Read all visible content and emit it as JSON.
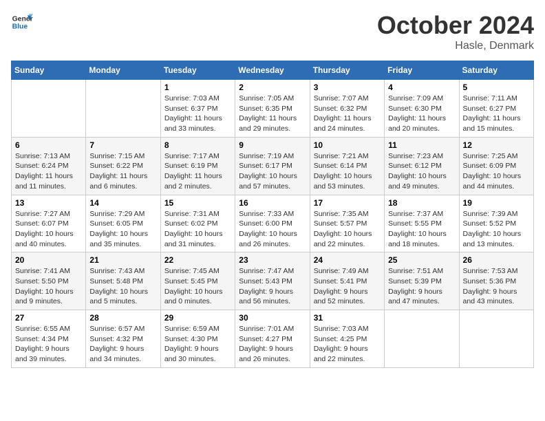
{
  "header": {
    "logo_line1": "General",
    "logo_line2": "Blue",
    "month": "October 2024",
    "location": "Hasle, Denmark"
  },
  "weekdays": [
    "Sunday",
    "Monday",
    "Tuesday",
    "Wednesday",
    "Thursday",
    "Friday",
    "Saturday"
  ],
  "weeks": [
    [
      {
        "day": "",
        "info": ""
      },
      {
        "day": "",
        "info": ""
      },
      {
        "day": "1",
        "info": "Sunrise: 7:03 AM\nSunset: 6:37 PM\nDaylight: 11 hours\nand 33 minutes."
      },
      {
        "day": "2",
        "info": "Sunrise: 7:05 AM\nSunset: 6:35 PM\nDaylight: 11 hours\nand 29 minutes."
      },
      {
        "day": "3",
        "info": "Sunrise: 7:07 AM\nSunset: 6:32 PM\nDaylight: 11 hours\nand 24 minutes."
      },
      {
        "day": "4",
        "info": "Sunrise: 7:09 AM\nSunset: 6:30 PM\nDaylight: 11 hours\nand 20 minutes."
      },
      {
        "day": "5",
        "info": "Sunrise: 7:11 AM\nSunset: 6:27 PM\nDaylight: 11 hours\nand 15 minutes."
      }
    ],
    [
      {
        "day": "6",
        "info": "Sunrise: 7:13 AM\nSunset: 6:24 PM\nDaylight: 11 hours\nand 11 minutes."
      },
      {
        "day": "7",
        "info": "Sunrise: 7:15 AM\nSunset: 6:22 PM\nDaylight: 11 hours\nand 6 minutes."
      },
      {
        "day": "8",
        "info": "Sunrise: 7:17 AM\nSunset: 6:19 PM\nDaylight: 11 hours\nand 2 minutes."
      },
      {
        "day": "9",
        "info": "Sunrise: 7:19 AM\nSunset: 6:17 PM\nDaylight: 10 hours\nand 57 minutes."
      },
      {
        "day": "10",
        "info": "Sunrise: 7:21 AM\nSunset: 6:14 PM\nDaylight: 10 hours\nand 53 minutes."
      },
      {
        "day": "11",
        "info": "Sunrise: 7:23 AM\nSunset: 6:12 PM\nDaylight: 10 hours\nand 49 minutes."
      },
      {
        "day": "12",
        "info": "Sunrise: 7:25 AM\nSunset: 6:09 PM\nDaylight: 10 hours\nand 44 minutes."
      }
    ],
    [
      {
        "day": "13",
        "info": "Sunrise: 7:27 AM\nSunset: 6:07 PM\nDaylight: 10 hours\nand 40 minutes."
      },
      {
        "day": "14",
        "info": "Sunrise: 7:29 AM\nSunset: 6:05 PM\nDaylight: 10 hours\nand 35 minutes."
      },
      {
        "day": "15",
        "info": "Sunrise: 7:31 AM\nSunset: 6:02 PM\nDaylight: 10 hours\nand 31 minutes."
      },
      {
        "day": "16",
        "info": "Sunrise: 7:33 AM\nSunset: 6:00 PM\nDaylight: 10 hours\nand 26 minutes."
      },
      {
        "day": "17",
        "info": "Sunrise: 7:35 AM\nSunset: 5:57 PM\nDaylight: 10 hours\nand 22 minutes."
      },
      {
        "day": "18",
        "info": "Sunrise: 7:37 AM\nSunset: 5:55 PM\nDaylight: 10 hours\nand 18 minutes."
      },
      {
        "day": "19",
        "info": "Sunrise: 7:39 AM\nSunset: 5:52 PM\nDaylight: 10 hours\nand 13 minutes."
      }
    ],
    [
      {
        "day": "20",
        "info": "Sunrise: 7:41 AM\nSunset: 5:50 PM\nDaylight: 10 hours\nand 9 minutes."
      },
      {
        "day": "21",
        "info": "Sunrise: 7:43 AM\nSunset: 5:48 PM\nDaylight: 10 hours\nand 5 minutes."
      },
      {
        "day": "22",
        "info": "Sunrise: 7:45 AM\nSunset: 5:45 PM\nDaylight: 10 hours\nand 0 minutes."
      },
      {
        "day": "23",
        "info": "Sunrise: 7:47 AM\nSunset: 5:43 PM\nDaylight: 9 hours\nand 56 minutes."
      },
      {
        "day": "24",
        "info": "Sunrise: 7:49 AM\nSunset: 5:41 PM\nDaylight: 9 hours\nand 52 minutes."
      },
      {
        "day": "25",
        "info": "Sunrise: 7:51 AM\nSunset: 5:39 PM\nDaylight: 9 hours\nand 47 minutes."
      },
      {
        "day": "26",
        "info": "Sunrise: 7:53 AM\nSunset: 5:36 PM\nDaylight: 9 hours\nand 43 minutes."
      }
    ],
    [
      {
        "day": "27",
        "info": "Sunrise: 6:55 AM\nSunset: 4:34 PM\nDaylight: 9 hours\nand 39 minutes."
      },
      {
        "day": "28",
        "info": "Sunrise: 6:57 AM\nSunset: 4:32 PM\nDaylight: 9 hours\nand 34 minutes."
      },
      {
        "day": "29",
        "info": "Sunrise: 6:59 AM\nSunset: 4:30 PM\nDaylight: 9 hours\nand 30 minutes."
      },
      {
        "day": "30",
        "info": "Sunrise: 7:01 AM\nSunset: 4:27 PM\nDaylight: 9 hours\nand 26 minutes."
      },
      {
        "day": "31",
        "info": "Sunrise: 7:03 AM\nSunset: 4:25 PM\nDaylight: 9 hours\nand 22 minutes."
      },
      {
        "day": "",
        "info": ""
      },
      {
        "day": "",
        "info": ""
      }
    ]
  ]
}
